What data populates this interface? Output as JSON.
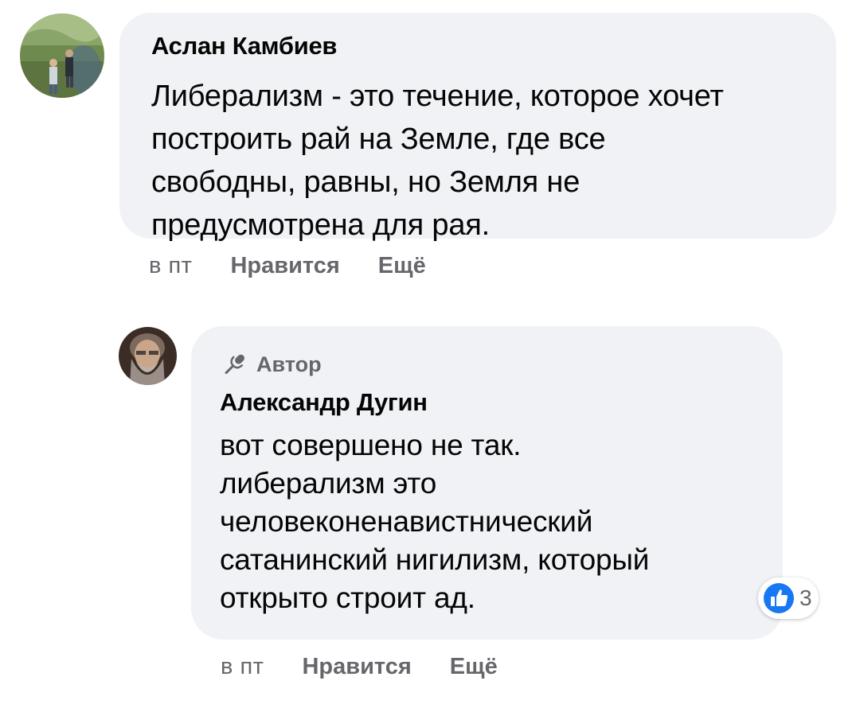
{
  "comments": [
    {
      "author": "Аслан Камбиев",
      "lines": [
        "Либерализм - это течение, которое хочет",
        "построить рай на Земле, где все",
        "свободны, равны, но Земля не",
        "предусмотрена для рая."
      ],
      "time": "в пт",
      "like_label": "Нравится",
      "more_label": "Ещё"
    },
    {
      "badge": "Автор",
      "author": "Александр Дугин",
      "lines": [
        "вот совершено не так.",
        "либерализм это",
        "человеконенавистнический",
        "сатанинский нигилизм, который",
        "открыто строит ад."
      ],
      "time": "в пт",
      "like_label": "Нравится",
      "more_label": "Ещё",
      "reaction_count": "3"
    }
  ],
  "colors": {
    "bubble": "#f0f2f5",
    "text": "#050505",
    "secondary": "#65676b",
    "like_blue": "#1877f2"
  },
  "icons": {
    "author_badge": "microphone-icon",
    "reaction": "thumbs-up-icon"
  }
}
